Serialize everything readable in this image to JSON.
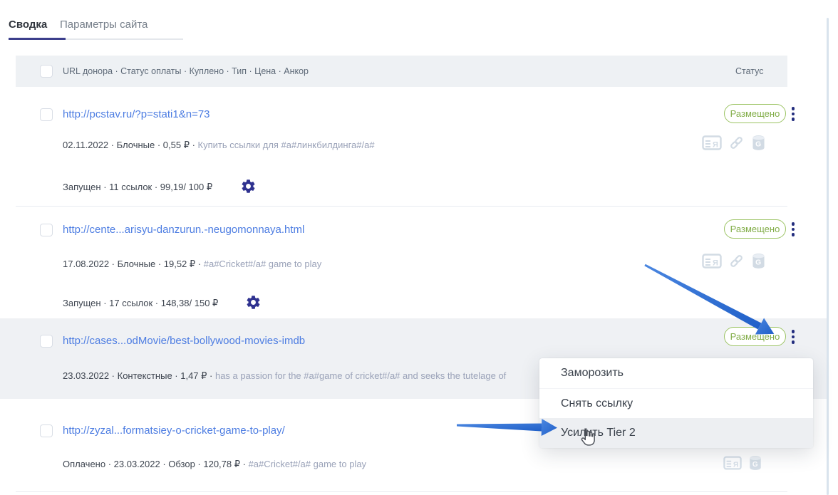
{
  "tabs": [
    {
      "label": "Сводка",
      "active": true
    },
    {
      "label": "Параметры сайта",
      "active": false
    }
  ],
  "table": {
    "columns_label": "URL донора · Статус оплаты · Куплено · Тип · Цена · Анкор",
    "status_label": "Статус"
  },
  "rows": [
    {
      "url": "http://pcstav.ru/?p=stati1&n=73",
      "status": "Размещено",
      "meta": "02.11.2022 · Блочные · 0,55 ₽ · ",
      "anchor": "Купить ссылки для #a#линкбилдинга#/a#",
      "progress": "Запущен · 11 ссылок · 99,19/ 100 ₽"
    },
    {
      "url": "http://cente...arisyu-danzurun.-neugomonnaya.html",
      "status": "Размещено",
      "meta": "17.08.2022 · Блочные · 19,52 ₽ · ",
      "anchor": "#a#Cricket#/a# game to play",
      "progress": "Запущен · 17 ссылок · 148,38/ 150 ₽"
    },
    {
      "url": "http://cases...odMovie/best-bollywood-movies-imdb",
      "status": "Размещено",
      "meta": "23.03.2022 · Контекстные · 1,47 ₽ · ",
      "anchor": "has a passion for the #a#game of cricket#/a# and seeks the tutelage of"
    },
    {
      "url": "http://zyzal...formatsiey-o-cricket-game-to-play/",
      "meta": "Оплачено · 23.03.2022 · Обзор · 120,78 ₽ · ",
      "anchor": "#a#Cricket#/a# game to play"
    }
  ],
  "context_menu": {
    "items": [
      {
        "label": "Заморозить"
      },
      {
        "label": "Снять ссылку"
      },
      {
        "label": "Усилить Tier 2",
        "hovered": true
      }
    ]
  },
  "icons": {
    "yandex_page": "browser-window-with-Я",
    "google_cache": "database-cylinder-with-G",
    "link": "chain-link",
    "gear": "settings-gear",
    "kebab": "vertical-three-dots",
    "hand": "hand-pointer-cursor"
  },
  "colors": {
    "arrow_blue": "#2a6ace",
    "badge_green": "#9cc464",
    "url_blue": "#4d7de2",
    "gear_indigo": "#2f3290",
    "anchor_gray": "#9aa2b8",
    "row_highlight": "#eff1f4"
  }
}
